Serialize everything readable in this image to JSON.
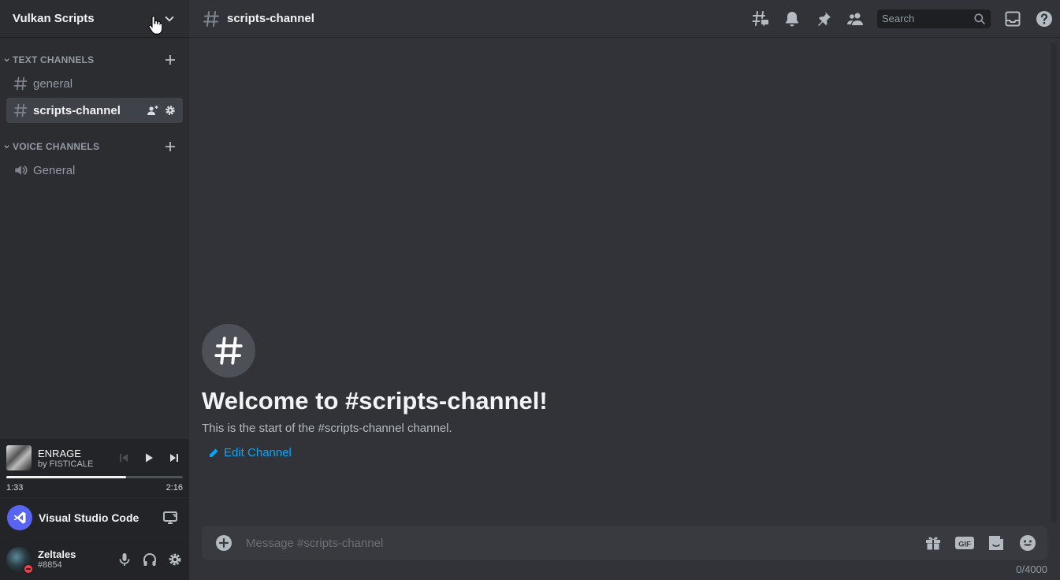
{
  "server": {
    "name": "Vulkan Scripts"
  },
  "categories": {
    "text": {
      "label": "TEXT CHANNELS"
    },
    "voice": {
      "label": "VOICE CHANNELS"
    }
  },
  "channels": {
    "text": [
      {
        "label": "general"
      },
      {
        "label": "scripts-channel"
      }
    ],
    "voice": [
      {
        "label": "General"
      }
    ]
  },
  "music": {
    "title": "ENRAGE",
    "artist": "by FISTICALE",
    "elapsed": "1:33",
    "duration": "2:16",
    "progress_percent": 68
  },
  "activity": {
    "name": "Visual Studio Code"
  },
  "user": {
    "name": "Zeltales",
    "tag": "#8854",
    "status": "dnd"
  },
  "header": {
    "channel_name": "scripts-channel",
    "search_placeholder": "Search"
  },
  "welcome": {
    "title": "Welcome to #scripts-channel!",
    "subtitle": "This is the start of the #scripts-channel channel.",
    "edit_label": "Edit Channel"
  },
  "composer": {
    "placeholder": "Message #scripts-channel",
    "char_count": "0/4000"
  },
  "colors": {
    "accent": "#5865f2",
    "link": "#00a8fc",
    "dnd": "#f23f43"
  }
}
